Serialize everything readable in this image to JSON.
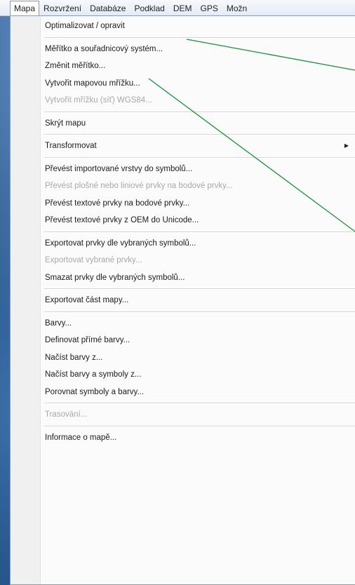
{
  "menubar": {
    "items": [
      "Mapa",
      "Rozvržení",
      "Databáze",
      "Podklad",
      "DEM",
      "GPS",
      "Možn"
    ]
  },
  "menu": {
    "items": [
      {
        "label": "Optimalizovat / opravit",
        "disabled": false
      },
      {
        "sep": true
      },
      {
        "label": "Měřítko a souřadnicový systém...",
        "disabled": false
      },
      {
        "label": "Změnit měřítko...",
        "disabled": false
      },
      {
        "label": "Vytvořit mapovou mřížku...",
        "disabled": false
      },
      {
        "label": "Vytvořit mřížku (síť) WGS84...",
        "disabled": true
      },
      {
        "sep": true
      },
      {
        "label": "Skrýt mapu",
        "disabled": false
      },
      {
        "sep": true
      },
      {
        "label": "Transformovat",
        "disabled": false,
        "submenu": true
      },
      {
        "sep": true
      },
      {
        "label": "Převést importované vrstvy do symbolů...",
        "disabled": false
      },
      {
        "label": "Převést plošné nebo liniové prvky na bodové prvky...",
        "disabled": true
      },
      {
        "label": "Převést textové prvky na bodové prvky...",
        "disabled": false
      },
      {
        "label": "Převést textové prvky z OEM do Unicode...",
        "disabled": false
      },
      {
        "sep": true
      },
      {
        "label": "Exportovat prvky dle vybraných symbolů...",
        "disabled": false
      },
      {
        "label": "Exportovat vybrané prvky...",
        "disabled": true
      },
      {
        "label": "Smazat prvky dle vybraných symbolů...",
        "disabled": false
      },
      {
        "sep": true
      },
      {
        "label": "Exportovat část mapy...",
        "disabled": false
      },
      {
        "sep": true
      },
      {
        "label": "Barvy...",
        "disabled": false
      },
      {
        "label": "Definovat přímé barvy...",
        "disabled": false
      },
      {
        "label": "Načíst barvy z...",
        "disabled": false
      },
      {
        "label": "Načíst barvy a symboly z...",
        "disabled": false
      },
      {
        "label": "Porovnat symboly a barvy...",
        "disabled": false
      },
      {
        "sep": true
      },
      {
        "label": "Trasování...",
        "disabled": true
      },
      {
        "sep": true
      },
      {
        "label": "Informace o mapě...",
        "disabled": false
      }
    ]
  },
  "colors": {
    "annotation_line": "#1a8f3a",
    "disabled_text": "#a8a8a8"
  }
}
